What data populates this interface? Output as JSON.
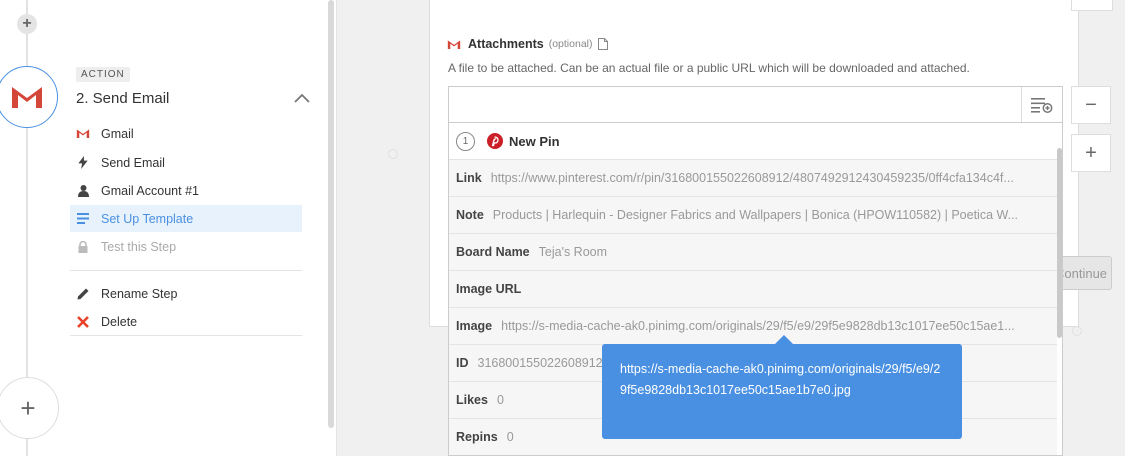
{
  "sidebar": {
    "action_badge": "ACTION",
    "step_title": "2. Send Email",
    "menu": [
      {
        "label": "Gmail",
        "icon": "gmail-icon"
      },
      {
        "label": "Send Email",
        "icon": "lightning-icon"
      },
      {
        "label": "Gmail Account #1",
        "icon": "user-icon"
      },
      {
        "label": "Set Up Template",
        "icon": "list-icon",
        "active": true
      },
      {
        "label": "Test this Step",
        "icon": "lock-icon",
        "disabled": true
      }
    ],
    "actions": [
      {
        "label": "Rename Step",
        "icon": "pencil-icon"
      },
      {
        "label": "Delete",
        "icon": "delete-x-icon"
      }
    ],
    "add_step_symbol": "+"
  },
  "field": {
    "label": "Attachments",
    "optional": "(optional)",
    "help": "A file to be attached. Can be an actual file or a public URL which will be downloaded and attached.",
    "value": ""
  },
  "side_buttons": {
    "minus": "−",
    "plus": "+"
  },
  "continue_label": "Continue",
  "dropdown": {
    "step_number": "1",
    "app_name": "New Pin",
    "rows": [
      {
        "key": "Link",
        "value": "https://www.pinterest.com/r/pin/316800155022608912/4807492912430459235/0ff4cfa134c4f..."
      },
      {
        "key": "Note",
        "value": "Products | Harlequin - Designer Fabrics and Wallpapers | Bonica (HPOW110582) | Poetica W..."
      },
      {
        "key": "Board Name",
        "value": "Teja's Room"
      },
      {
        "key": "Image URL",
        "value": ""
      },
      {
        "key": "Image",
        "value": "https://s-media-cache-ak0.pinimg.com/originals/29/f5/e9/29f5e9828db13c1017ee50c15ae1..."
      },
      {
        "key": "ID",
        "value": "316800155022608912"
      },
      {
        "key": "Likes",
        "value": "0"
      },
      {
        "key": "Repins",
        "value": "0"
      }
    ]
  },
  "tooltip": "https://s-media-cache-ak0.pinimg.com/originals/29/f5/e9/29f5e9828db13c1017ee50c15ae1b7e0.jpg",
  "colors": {
    "accent": "#4a90e2",
    "delete": "#e8432a",
    "gmail": "#d44638",
    "pinterest": "#cb2027"
  }
}
